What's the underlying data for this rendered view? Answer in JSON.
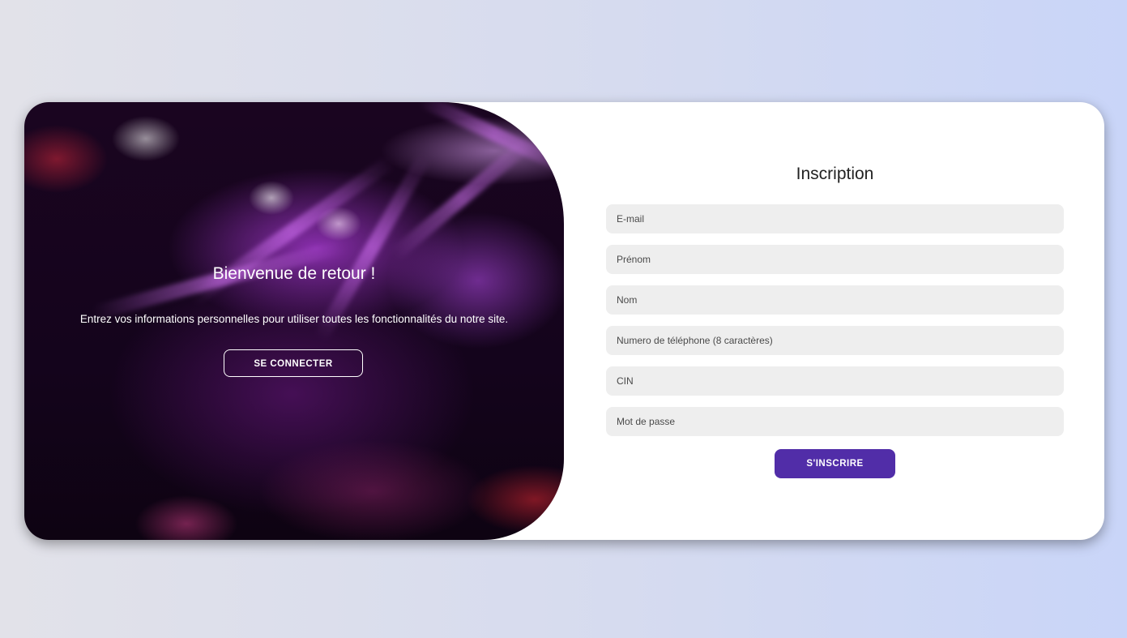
{
  "colors": {
    "accent": "#512da8",
    "field_bg": "#eeeeee",
    "card_bg": "#ffffff"
  },
  "toggle": {
    "title": "Bienvenue de retour !",
    "text": "Entrez vos informations personnelles pour utiliser toutes les fonctionnalités du notre site.",
    "login_button": "SE CONNECTER"
  },
  "signup": {
    "title": "Inscription",
    "fields": {
      "email": {
        "placeholder": "E-mail",
        "value": ""
      },
      "prenom": {
        "placeholder": "Prénom",
        "value": ""
      },
      "nom": {
        "placeholder": "Nom",
        "value": ""
      },
      "telephone": {
        "placeholder": "Numero de téléphone (8 caractères)",
        "value": ""
      },
      "cin": {
        "placeholder": "CIN",
        "value": ""
      },
      "password": {
        "placeholder": "Mot de passe",
        "value": ""
      }
    },
    "submit_button": "S'INSCRIRE"
  }
}
